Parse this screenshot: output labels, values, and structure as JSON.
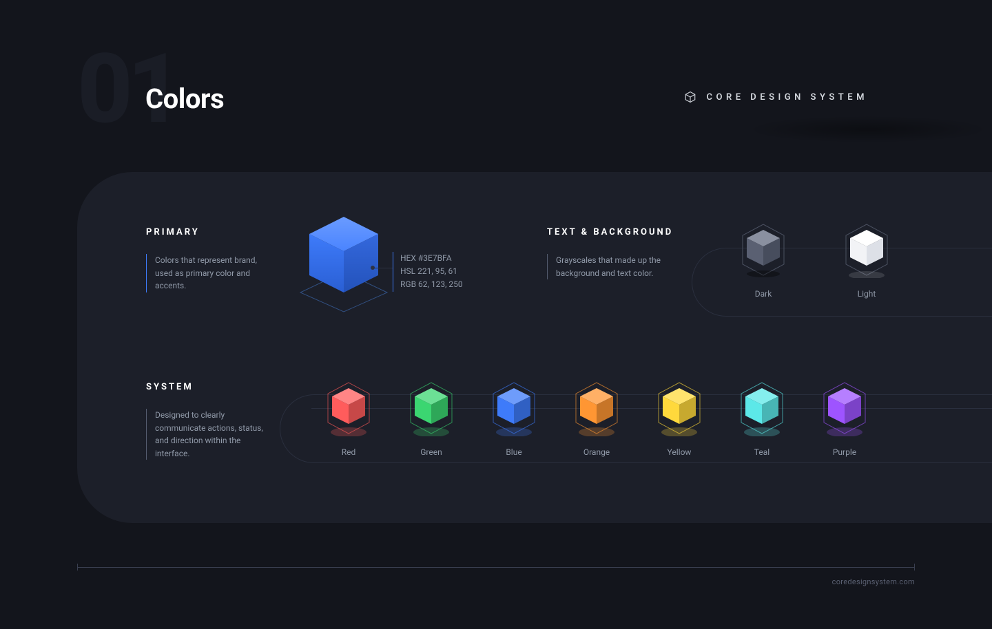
{
  "header": {
    "index": "01",
    "title": "Colors",
    "brand": "CORE DESIGN SYSTEM"
  },
  "primary": {
    "heading": "PRIMARY",
    "description": "Colors that represent brand, used as primary color and accents.",
    "spec_hex": "HEX #3E7BFA",
    "spec_hsl": "HSL 221, 95, 61",
    "spec_rgb": "RGB 62, 123, 250",
    "color": "#3E7BFA"
  },
  "text_background": {
    "heading": "TEXT & BACKGROUND",
    "description": "Grayscales that made up the background and text color.",
    "swatches": [
      {
        "label": "Dark",
        "color": "#5a6072",
        "highlight": "#8a90a0"
      },
      {
        "label": "Light",
        "color": "#ffffff",
        "highlight": "#e6e8ee"
      }
    ]
  },
  "system": {
    "heading": "SYSTEM",
    "description": "Designed to clearly communicate actions, status, and direction within the interface.",
    "swatches": [
      {
        "label": "Red",
        "color": "#ff5c5c"
      },
      {
        "label": "Green",
        "color": "#3bd671"
      },
      {
        "label": "Blue",
        "color": "#3E7BFA"
      },
      {
        "label": "Orange",
        "color": "#ff9633"
      },
      {
        "label": "Yellow",
        "color": "#ffd93c"
      },
      {
        "label": "Teal",
        "color": "#5ce8e8"
      },
      {
        "label": "Purple",
        "color": "#9e54ff"
      }
    ]
  },
  "footer": {
    "url": "coredesignsystem.com"
  }
}
